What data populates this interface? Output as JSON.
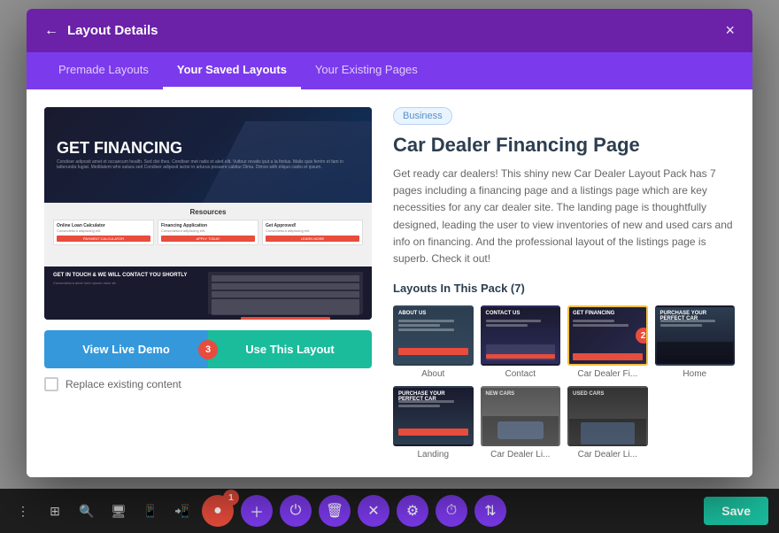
{
  "modal": {
    "title": "Layout Details",
    "close_label": "×",
    "back_icon": "←"
  },
  "tabs": {
    "premade": "Premade Layouts",
    "saved": "Your Saved Layouts",
    "existing": "Your Existing Pages",
    "active": "saved"
  },
  "layout": {
    "badge": "Business",
    "title": "Car Dealer Financing Page",
    "description": "Get ready car dealers! This shiny new Car Dealer Layout Pack has 7 pages including a financing page and a listings page which are key necessities for any car dealer site. The landing page is thoughtfully designed, leading the user to view inventories of new and used cars and info on financing. And the professional layout of the listings page is superb. Check it out!",
    "pack_label": "Layouts In This Pack (7)"
  },
  "preview": {
    "headline": "GET FINANCING",
    "resources_title": "Resources",
    "contact_title": "GET IN TOUCH & WE WILL CONTACT YOU SHORTLY"
  },
  "thumbnails": [
    {
      "label": "About",
      "style": "about"
    },
    {
      "label": "Contact",
      "style": "contact"
    },
    {
      "label": "Car Dealer Fi...",
      "style": "financing",
      "active": true,
      "badge": "2"
    },
    {
      "label": "Home",
      "style": "home"
    },
    {
      "label": "Landing",
      "style": "landing"
    },
    {
      "label": "Car Dealer Li...",
      "style": "dealer1"
    },
    {
      "label": "Car Dealer Li...",
      "style": "used"
    }
  ],
  "actions": {
    "live_demo": "View Live Demo",
    "use_layout": "Use This Layout",
    "badge": "3",
    "replace_label": "Replace existing content"
  },
  "toolbar": {
    "save_label": "Save",
    "badge_1": "1"
  }
}
